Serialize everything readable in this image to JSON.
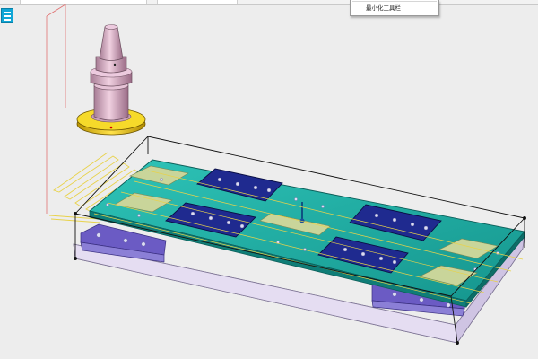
{
  "context_menu": {
    "item_label": "最小化工具栏"
  },
  "colors": {
    "background": "#ededed",
    "plate_teal": "#1aa39a",
    "pocket_navy": "#1f2a8f",
    "base_lavender": "#ddd4ee",
    "holder_pink": "#d8b0c6",
    "holder_gold": "#e8c000",
    "toolpath_yellow": "#e8d24a",
    "axis_red": "#e07070",
    "side_button": "#10a6d6"
  },
  "icons": {
    "side_button": "view-toggle-icon",
    "tool_holder": "tool-holder-icon",
    "tool_tip": "tool-tip-icon"
  }
}
